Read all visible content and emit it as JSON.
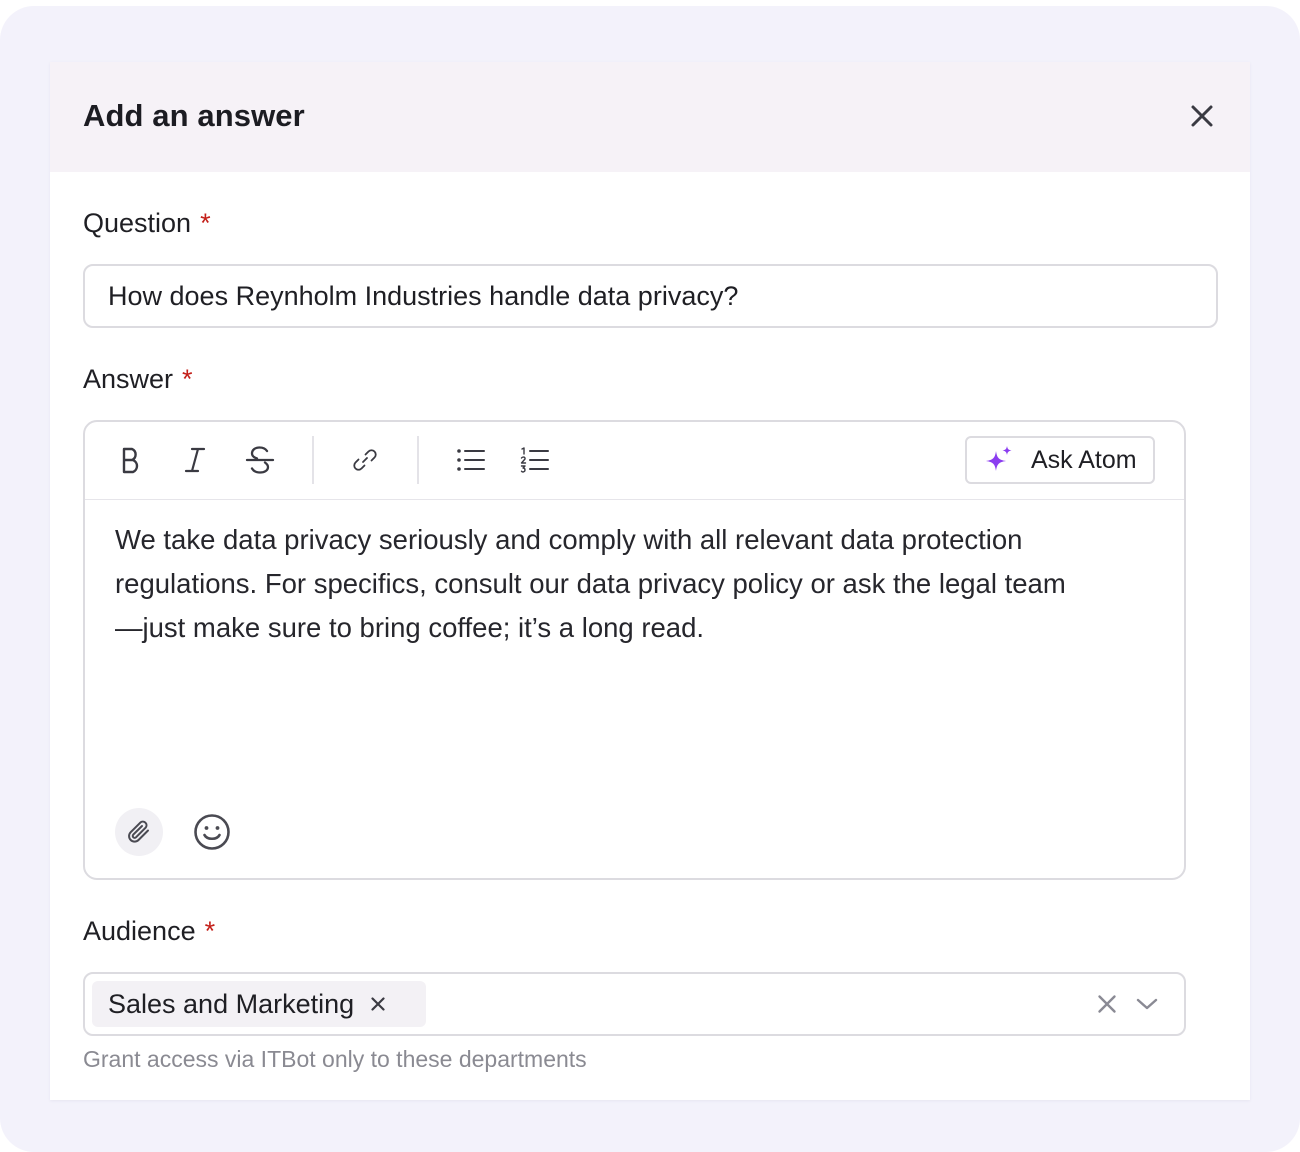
{
  "modal": {
    "title": "Add an answer",
    "close_icon": "close-icon"
  },
  "question": {
    "label": "Question",
    "required_mark": "*",
    "value": "How does Reynholm Industries handle data privacy?"
  },
  "answer": {
    "label": "Answer",
    "required_mark": "*",
    "toolbar": {
      "items": [
        "bold-icon",
        "italic-icon",
        "strikethrough-icon",
        "link-icon",
        "bullet-list-icon",
        "numbered-list-icon"
      ],
      "ask_atom_label": "Ask Atom",
      "ask_atom_icon": "sparkle-icon"
    },
    "body_line1": "We take data privacy seriously and comply with all relevant data protection",
    "body_line2": "regulations. For specifics, consult our data privacy policy or ask the legal team",
    "body_line3": "—just make sure to bring coffee; it’s a long read.",
    "footer_icons": [
      "paperclip-icon",
      "smiley-icon"
    ]
  },
  "audience": {
    "label": "Audience",
    "required_mark": "*",
    "selected": [
      {
        "label": "Sales and Marketing"
      }
    ],
    "helper_text": "Grant access via ITBot only to these departments"
  },
  "colors": {
    "backdrop": "#f3f2fb",
    "header_bg": "#f6f2f7",
    "required": "#c4201a",
    "sparkle_purple": "#8b3df0",
    "border": "#dcdbe0"
  }
}
